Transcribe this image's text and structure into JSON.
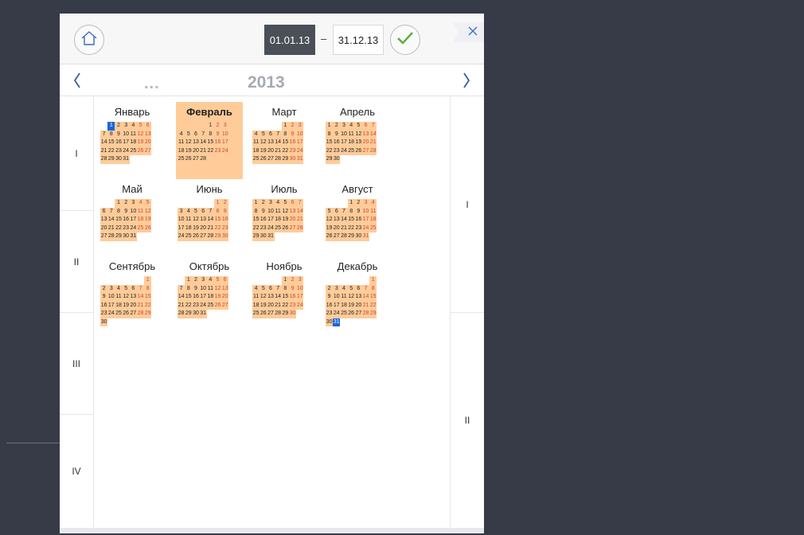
{
  "header": {
    "home_icon": "home-icon",
    "date_from": "01.01.13",
    "separator": "–",
    "date_to": "31.12.13",
    "confirm_icon": "check-icon",
    "close_icon": "close-icon",
    "confirm_color": "#5aae3c"
  },
  "year_nav": {
    "prev_icon": "chevron-left-icon",
    "next_icon": "chevron-right-icon",
    "ellipsis": "...",
    "year": "2013"
  },
  "quarters": [
    "I",
    "II",
    "III",
    "IV"
  ],
  "halves": [
    "I",
    "II"
  ],
  "colors": {
    "selected_month_bg": "#ffcc99",
    "weekend": "#d0442b",
    "selected_day": "#1565e0"
  },
  "months": [
    {
      "name": "Январь",
      "offset": 1,
      "days": 31
    },
    {
      "name": "Февраль",
      "offset": 4,
      "days": 28
    },
    {
      "name": "Март",
      "offset": 4,
      "days": 31
    },
    {
      "name": "Апрель",
      "offset": 0,
      "days": 30
    },
    {
      "name": "Май",
      "offset": 2,
      "days": 31
    },
    {
      "name": "Июнь",
      "offset": 5,
      "days": 30
    },
    {
      "name": "Июль",
      "offset": 0,
      "days": 31
    },
    {
      "name": "Август",
      "offset": 3,
      "days": 31
    },
    {
      "name": "Сентябрь",
      "offset": 6,
      "days": 30
    },
    {
      "name": "Октябрь",
      "offset": 1,
      "days": 31
    },
    {
      "name": "Ноябрь",
      "offset": 4,
      "days": 30
    },
    {
      "name": "Декабрь",
      "offset": 6,
      "days": 31
    }
  ],
  "selected_month": "Февраль",
  "range_start": {
    "month": "Январь",
    "day": 1
  },
  "range_end": {
    "month": "Декабрь",
    "day": 31
  }
}
